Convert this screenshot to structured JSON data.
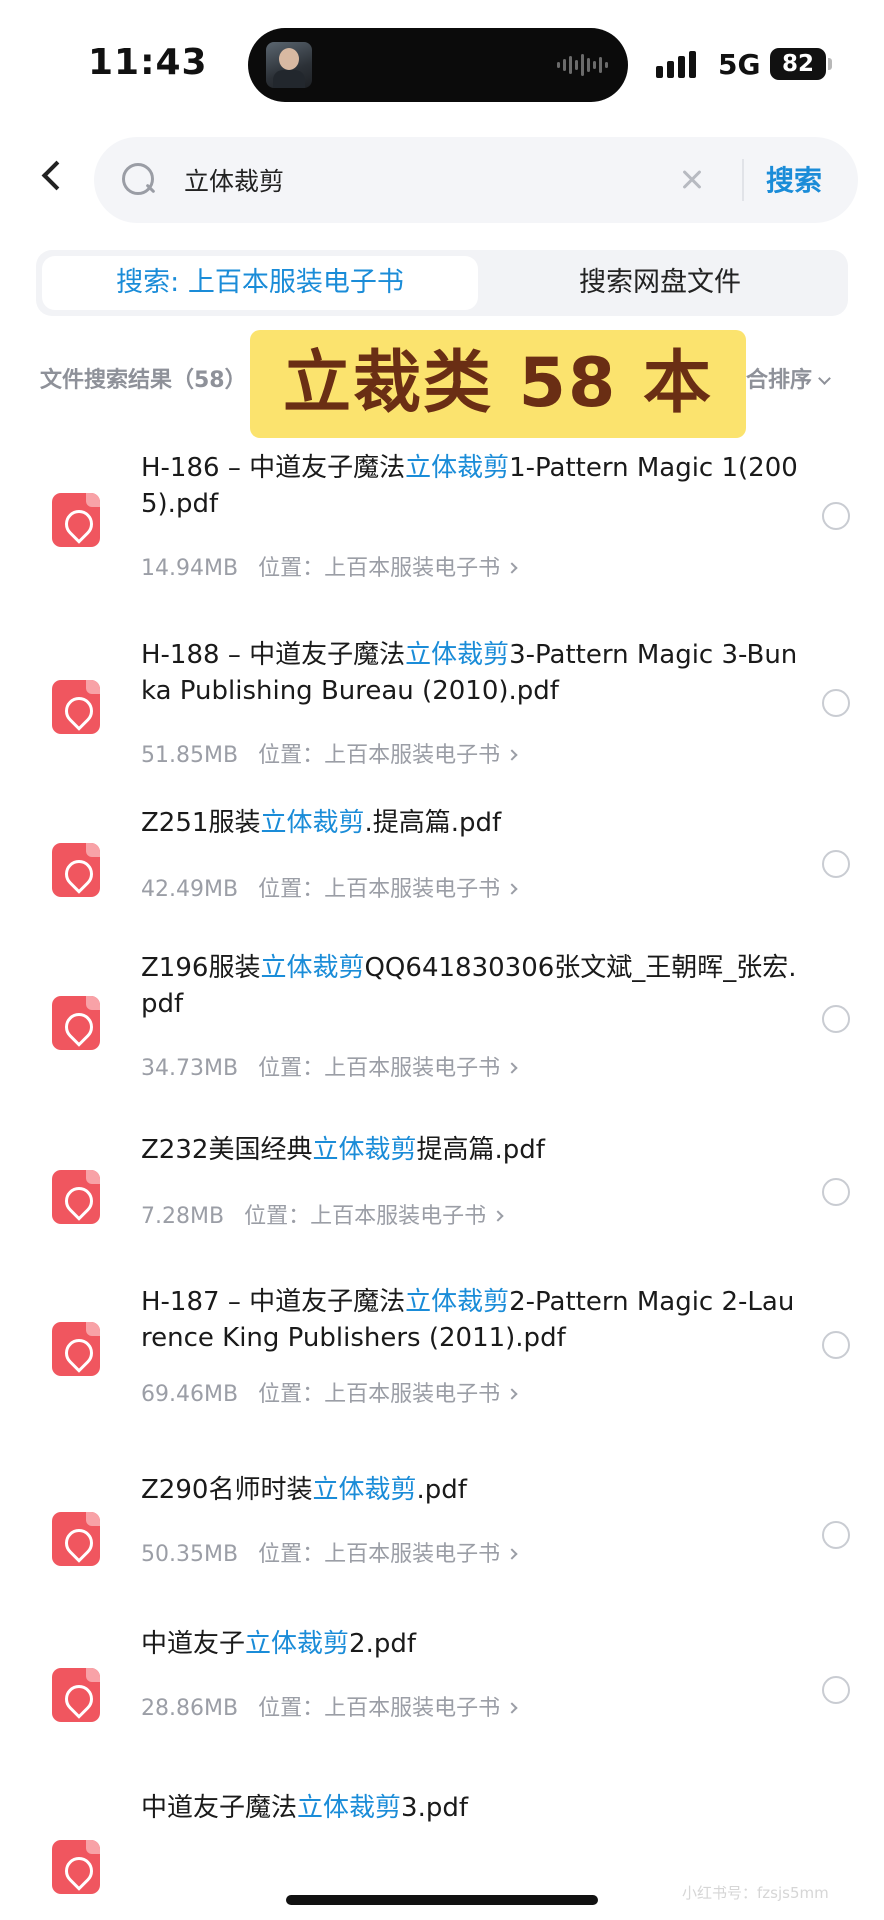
{
  "status_bar": {
    "time": "11:43",
    "network": "5G",
    "battery": "82"
  },
  "search": {
    "query": "立体裁剪",
    "submit_label": "搜索"
  },
  "tabs": [
    {
      "label": "搜索: 上百本服装电子书",
      "active": true
    },
    {
      "label": "搜索网盘文件",
      "active": false
    }
  ],
  "results": {
    "label": "文件搜索结果（58）",
    "sort_label": "合排序",
    "banner": "立裁类 58 本"
  },
  "files": [
    {
      "name_before": "H-186 – 中道友子魔法",
      "name_highlight": "立体裁剪",
      "name_after": "1-Pattern Magic 1(2005).pdf",
      "size": "14.94MB",
      "location": "位置：上百本服装电子书"
    },
    {
      "name_before": "H-188 – 中道友子魔法",
      "name_highlight": "立体裁剪",
      "name_after": "3-Pattern Magic 3-Bunka Publishing Bureau (2010).pdf",
      "size": "51.85MB",
      "location": "位置：上百本服装电子书"
    },
    {
      "name_before": "Z251服装",
      "name_highlight": "立体裁剪",
      "name_after": ".提高篇.pdf",
      "size": "42.49MB",
      "location": "位置：上百本服装电子书"
    },
    {
      "name_before": "Z196服装",
      "name_highlight": "立体裁剪",
      "name_after": "QQ641830306张文斌_王朝晖_张宏.pdf",
      "size": "34.73MB",
      "location": "位置：上百本服装电子书"
    },
    {
      "name_before": "Z232美国经典",
      "name_highlight": "立体裁剪",
      "name_after": "提高篇.pdf",
      "size": "7.28MB",
      "location": "位置：上百本服装电子书"
    },
    {
      "name_before": "H-187 – 中道友子魔法",
      "name_highlight": "立体裁剪",
      "name_after": "2-Pattern Magic 2-Laurence King Publishers (2011).pdf",
      "size": "69.46MB",
      "location": "位置：上百本服装电子书"
    },
    {
      "name_before": "Z290名师时装",
      "name_highlight": "立体裁剪",
      "name_after": ".pdf",
      "size": "50.35MB",
      "location": "位置：上百本服装电子书"
    },
    {
      "name_before": "中道友子",
      "name_highlight": "立体裁剪",
      "name_after": "2.pdf",
      "size": "28.86MB",
      "location": "位置：上百本服装电子书"
    },
    {
      "name_before": "中道友子魔法",
      "name_highlight": "立体裁剪",
      "name_after": "3.pdf",
      "size": "",
      "location": ""
    }
  ],
  "watermark": "小红书号：fzsjs5mm",
  "icons": {
    "back": "chevron-left-icon",
    "search": "search-icon",
    "clear": "close-icon",
    "file": "pdf-file-icon",
    "select": "radio-circle-icon"
  },
  "colors": {
    "accent": "#1a8cd8",
    "pdf_red": "#f0565f",
    "banner_bg": "#fbe36e",
    "banner_text": "#6a2e14"
  }
}
